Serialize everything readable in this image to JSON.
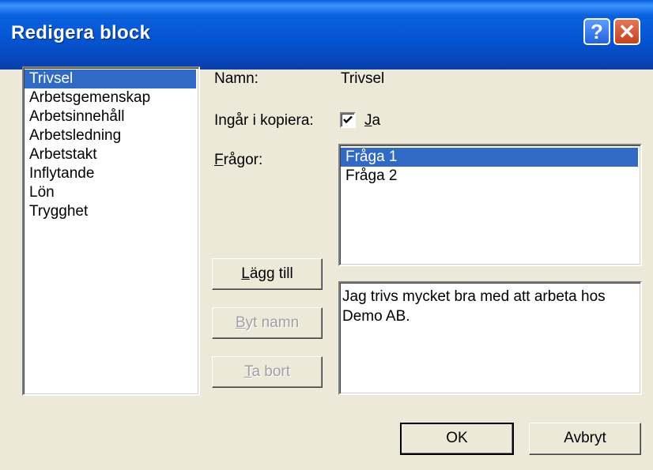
{
  "window": {
    "title": "Redigera block",
    "help_label": "?",
    "close_label": "✕"
  },
  "blocks": [
    "Trivsel",
    "Arbetsgemenskap",
    "Arbetsinnehåll",
    "Arbetsledning",
    "Arbetstakt",
    "Inflytande",
    "Lön",
    "Trygghet"
  ],
  "selected_block": "Trivsel",
  "form": {
    "name_label": "Namn:",
    "name_value": "Trivsel",
    "include_label": "Ingår i kopiera:",
    "include_checked": true,
    "include_option_accel": "J",
    "include_option_rest": "a",
    "questions_label_accel": "F",
    "questions_label_rest": "rågor:"
  },
  "questions": [
    "Fråga 1",
    "Fråga 2"
  ],
  "selected_question": "Fråga 1",
  "description": "Jag trivs mycket bra med att arbeta hos Demo AB.",
  "buttons": {
    "add_accel": "L",
    "add_rest": "ägg till",
    "rename_accel": "B",
    "rename_rest": "yt namn",
    "delete_accel": "T",
    "delete_rest": "a bort",
    "ok": "OK",
    "cancel": "Avbryt"
  }
}
